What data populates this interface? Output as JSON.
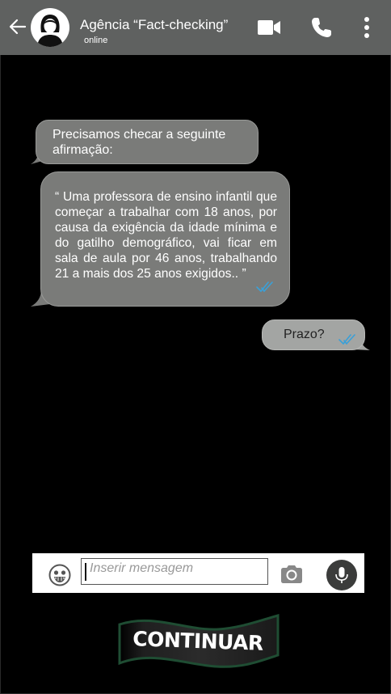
{
  "header": {
    "contact_name": "Agência “Fact-checking”",
    "status": "online"
  },
  "messages": [
    {
      "direction": "incoming",
      "text": "Precisamos checar a seguinte afirmação:"
    },
    {
      "direction": "incoming",
      "text": "“ Uma professora de ensino infantil que começar a trabalhar com 18 anos, por causa da exigência da idade mínima e do gatilho demográfico, vai ficar em sala de aula por 46 anos, trabalhando 21 a mais dos 25 anos exigidos.. ”"
    },
    {
      "direction": "outgoing",
      "text": "Prazo?"
    }
  ],
  "input": {
    "placeholder": "Inserir mensagem",
    "value": ""
  },
  "continue_button": {
    "label": "CONTINUAR"
  },
  "colors": {
    "header_bg": "#5f6160",
    "incoming_bubble": "#7a7b79",
    "outgoing_bubble": "#a3a5a3",
    "read_ticks": "#3aa0d8",
    "banner_green": "#1f4d33"
  },
  "icons": [
    "back-arrow-icon",
    "avatar",
    "video-call-icon",
    "phone-call-icon",
    "more-options-icon",
    "emoji-icon",
    "camera-icon",
    "microphone-icon",
    "double-check-icon"
  ]
}
